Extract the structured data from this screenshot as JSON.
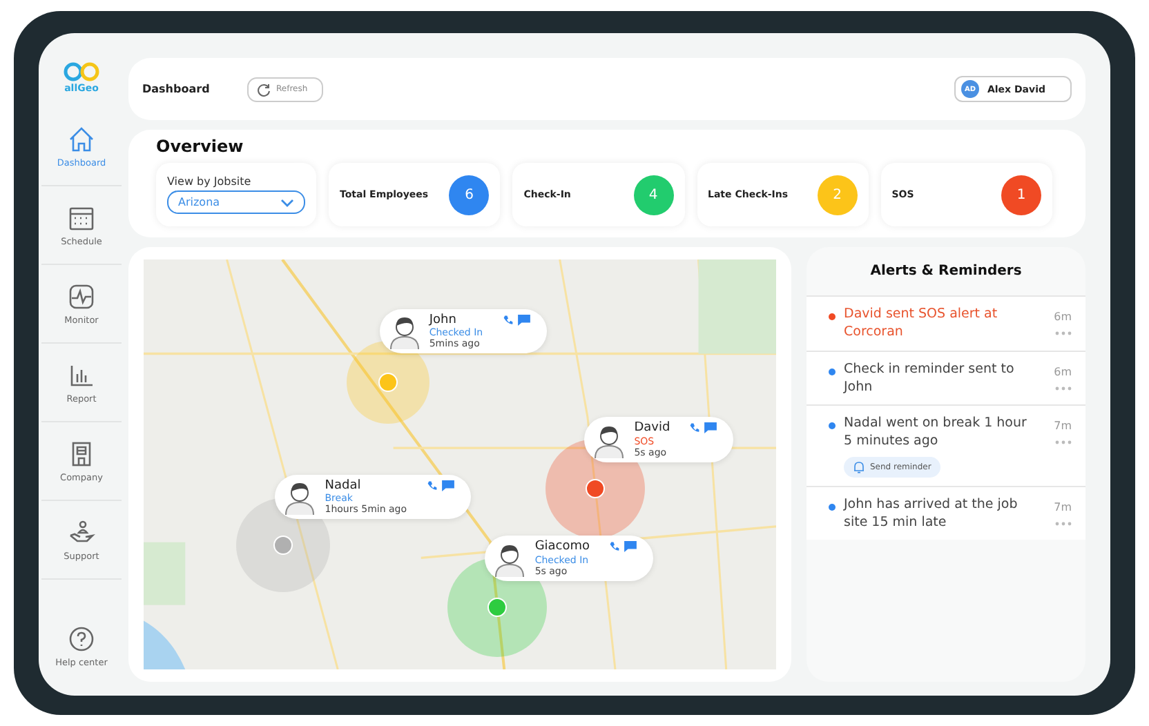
{
  "logo": {
    "text": "allGeo"
  },
  "sidebar": {
    "items": [
      {
        "label": "Dashboard",
        "selected": true
      },
      {
        "label": "Schedule",
        "selected": false
      },
      {
        "label": "Monitor",
        "selected": false
      },
      {
        "label": "Report",
        "selected": false
      },
      {
        "label": "Company",
        "selected": false
      },
      {
        "label": "Support",
        "selected": false
      },
      {
        "label": "Help center",
        "selected": false
      }
    ]
  },
  "header": {
    "title": "Dashboard",
    "refresh": "Refresh",
    "user": {
      "initials": "AD",
      "name": "Alex David"
    }
  },
  "overview": {
    "title": "Overview",
    "jobsite": {
      "label": "View by Jobsite",
      "value": "Arizona"
    },
    "stats": [
      {
        "label": "Total Employees",
        "value": "6",
        "color": "#2f86f0"
      },
      {
        "label": "Check-In",
        "value": "4",
        "color": "#22cc6e"
      },
      {
        "label": "Late Check-Ins",
        "value": "2",
        "color": "#fcc419"
      },
      {
        "label": "SOS",
        "value": "1",
        "color": "#f04a24"
      }
    ]
  },
  "map": {
    "markers": [
      {
        "name": "John",
        "status": "Checked In",
        "kind": "checked_in",
        "time": "5mins ago",
        "color": "#fcc419"
      },
      {
        "name": "David",
        "status": "SOS",
        "kind": "sos",
        "time": "5s ago",
        "color": "#f04a24"
      },
      {
        "name": "Nadal",
        "status": "Break",
        "kind": "break",
        "time": "1hours 5min ago",
        "color": "#b0b0b0"
      },
      {
        "name": "Giacomo",
        "status": "Checked In",
        "kind": "checked_in",
        "time": "5s ago",
        "color": "#2ecc40"
      }
    ]
  },
  "alerts": {
    "title": "Alerts & Reminders",
    "items": [
      {
        "text": "David sent SOS alert at Corcoran",
        "time": "6m",
        "kind": "sos",
        "color": "#f04a24"
      },
      {
        "text": "Check in reminder sent to John",
        "time": "6m",
        "kind": "info",
        "color": "#2f86f0"
      },
      {
        "text": "Nadal went on break 1 hour 5 minutes ago",
        "time": "7m",
        "kind": "info",
        "color": "#2f86f0",
        "action": "Send reminder"
      },
      {
        "text": "John has arrived at the job site 15 min late",
        "time": "7m",
        "kind": "info",
        "color": "#2f86f0"
      }
    ]
  }
}
